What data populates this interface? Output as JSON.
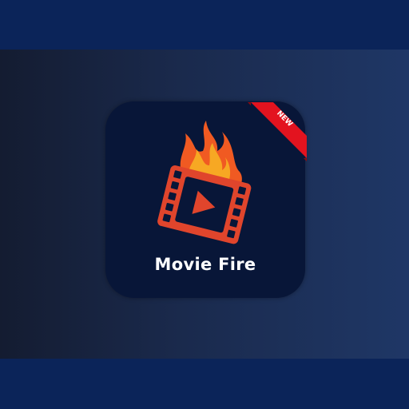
{
  "app": {
    "name": "Movie Fire",
    "badge": "NEW"
  },
  "icons": {
    "logo": "flaming-film-strip-play-icon"
  },
  "colors": {
    "band": "#0b2459",
    "backdrop_left": "#141c31",
    "backdrop_right": "#1f3766",
    "icon_bg": "#081638",
    "film": "#e0452c",
    "flame_outer": "#f05a22",
    "flame_inner": "#f7a823",
    "ribbon": "#e3131f",
    "text": "#ffffff"
  }
}
